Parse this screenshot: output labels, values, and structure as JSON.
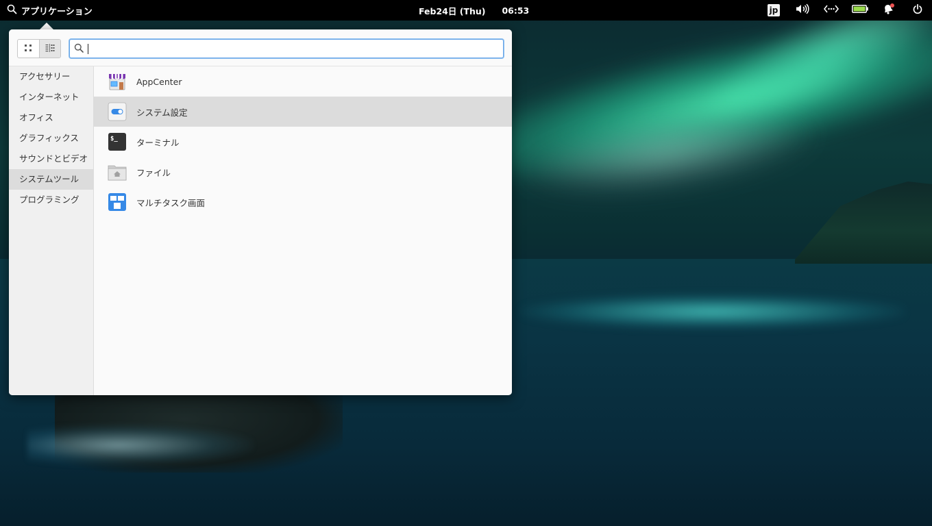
{
  "panel": {
    "applications_label": "アプリケーション",
    "date": "Feb24日 (Thu)",
    "time": "06:53",
    "keyboard_layout": "jp"
  },
  "launcher": {
    "search": {
      "value": "",
      "placeholder": ""
    },
    "categories": [
      {
        "label": "アクセサリー",
        "selected": false
      },
      {
        "label": "インターネット",
        "selected": false
      },
      {
        "label": "オフィス",
        "selected": false
      },
      {
        "label": "グラフィックス",
        "selected": false
      },
      {
        "label": "サウンドとビデオ",
        "selected": false
      },
      {
        "label": "システムツール",
        "selected": true
      },
      {
        "label": "プログラミング",
        "selected": false
      }
    ],
    "apps": [
      {
        "label": "AppCenter",
        "icon": "appcenter-icon"
      },
      {
        "label": "システム設定",
        "icon": "system-settings-icon"
      },
      {
        "label": "ターミナル",
        "icon": "terminal-icon"
      },
      {
        "label": "ファイル",
        "icon": "files-icon"
      },
      {
        "label": "マルチタスク画面",
        "icon": "multitasking-icon"
      }
    ]
  },
  "colors": {
    "panel_bg": "#000000",
    "popover_bg": "#fafafa",
    "selection_bg": "#dcdcdc",
    "accent": "#3689e6",
    "battery": "#9bdb4d",
    "notification_badge": "#ed5353"
  }
}
